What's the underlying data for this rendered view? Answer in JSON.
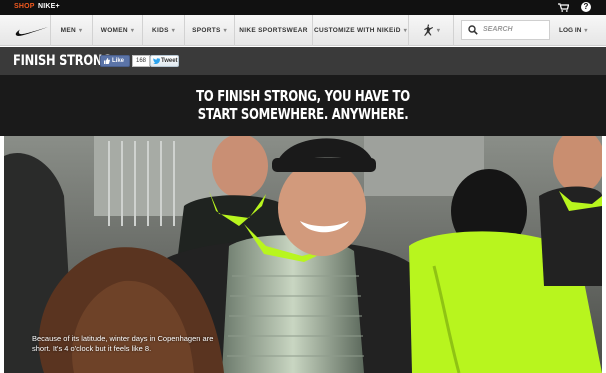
{
  "topbar": {
    "shop_label": "SHOP",
    "nikeplus_label": "NIKE+",
    "cart_icon": "cart-icon",
    "help_label": "?"
  },
  "nav": {
    "logo": "nike-swoosh-logo",
    "items": [
      {
        "label": "MEN"
      },
      {
        "label": "WOMEN"
      },
      {
        "label": "KIDS"
      },
      {
        "label": "SPORTS"
      },
      {
        "label": "NIKE SPORTSWEAR"
      },
      {
        "label": "CUSTOMIZE WITH NIKEiD"
      }
    ],
    "jordan_icon": "jumpman-icon",
    "search_placeholder": "SEARCH",
    "login_label": "LOG IN"
  },
  "subbar": {
    "title": "FINISH STRONG",
    "like_label": "Like",
    "like_count": "168",
    "tweet_label": "Tweet"
  },
  "headline": {
    "line1": "TO FINISH STRONG, YOU HAVE TO",
    "line2": "START SOMEWHERE. ANYWHERE."
  },
  "hero": {
    "caption": "Because of its latitude, winter days in Copenhagen are short. It's 4 o'clock but it feels like 8.",
    "accent_color": "#b8f51e"
  }
}
